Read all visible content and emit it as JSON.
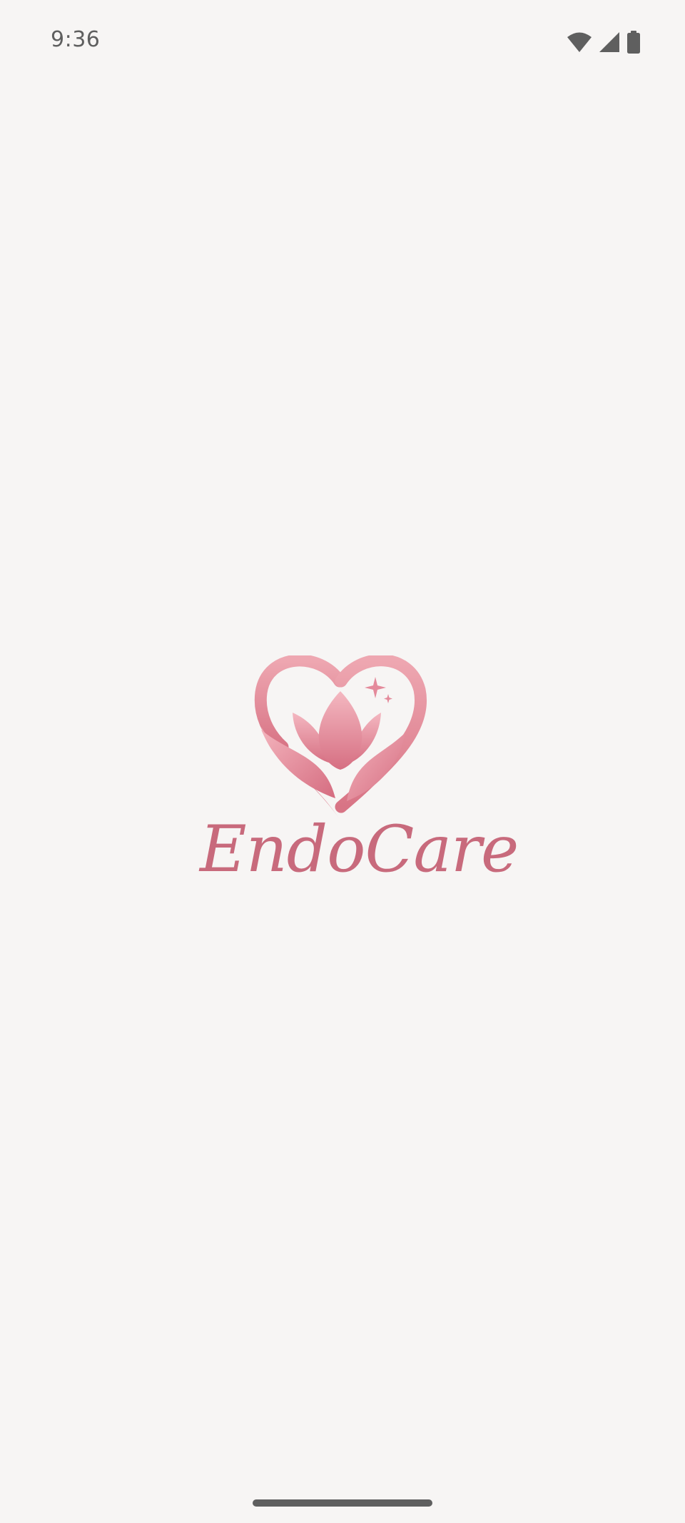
{
  "status_bar": {
    "time": "9:36",
    "icons": [
      "wifi-icon",
      "cellular-signal-icon",
      "battery-icon"
    ]
  },
  "splash": {
    "app_name": "EndoCare",
    "logo_icon": "heart-lotus-icon"
  },
  "colors": {
    "background": "#f7f5f4",
    "brand_pink": "#e8909f",
    "brand_deep": "#c86a7c",
    "status_icon": "#5f5f5f"
  }
}
